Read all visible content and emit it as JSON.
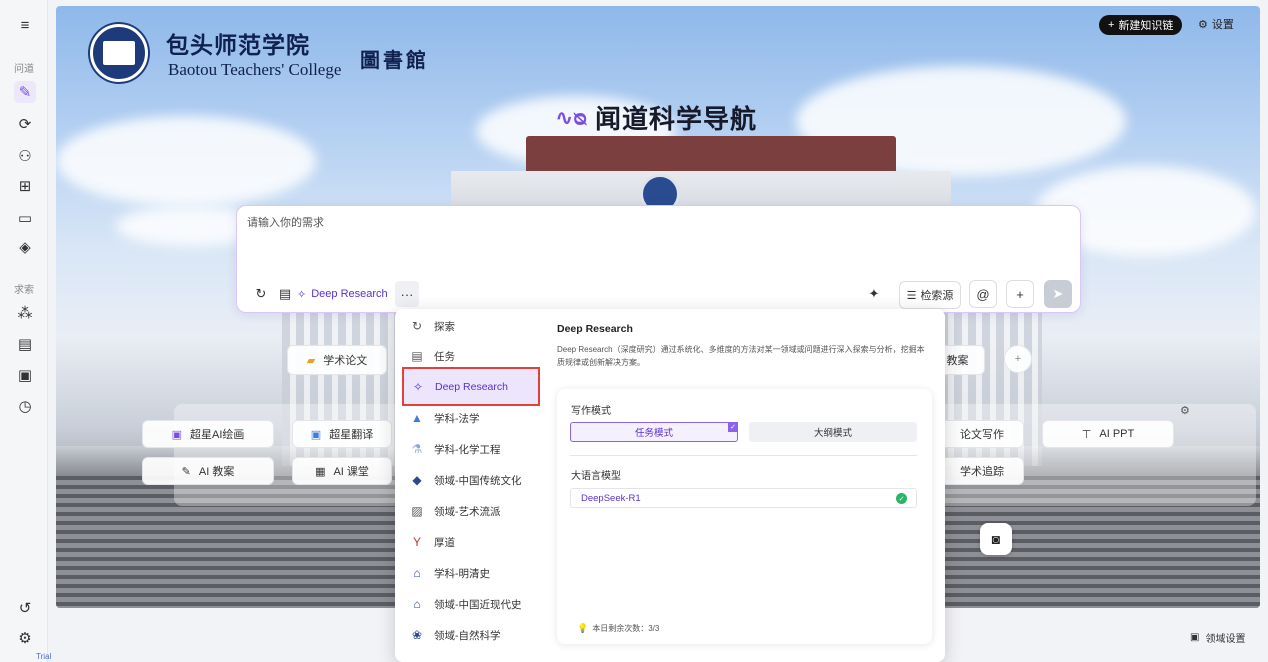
{
  "sidebar": {
    "menu_icon": "hamburger-icon",
    "section1_label": "问道",
    "section2_label": "求索",
    "trial_label": "Trial"
  },
  "header": {
    "college_cn": "包头师范学院",
    "college_en": "Baotou Teachers' College",
    "library_label": "圖書館",
    "new_chain_button": "新建知识链",
    "settings_label": "设置"
  },
  "brand": {
    "title": "闻道科学导航"
  },
  "search": {
    "placeholder": "请输入你的需求",
    "mode_label": "Deep Research",
    "more_label": "···",
    "source_label": "检索源",
    "at_label": "@",
    "plus_label": "+"
  },
  "chips": {
    "academic_paper": "学术论文",
    "lesson_plan": "教案",
    "chaoxing_ai_draw": "超星AI绘画",
    "chaoxing_translate": "超星翻译",
    "ai_lesson_plan": "AI 教案",
    "ai_class": "AI 课堂",
    "paper_writing": "论文写作",
    "ai_ppt": "AI PPT",
    "academic_tracking": "学术追踪"
  },
  "dropdown": {
    "items": [
      {
        "label": "探索",
        "icon": "explore-icon"
      },
      {
        "label": "任务",
        "icon": "task-icon"
      },
      {
        "label": "Deep Research",
        "icon": "telescope-icon"
      },
      {
        "label": "学科-法学",
        "icon": "law-icon"
      },
      {
        "label": "学科-化学工程",
        "icon": "chemistry-icon"
      },
      {
        "label": "领域-中国传统文化",
        "icon": "culture-icon"
      },
      {
        "label": "领域-艺术流派",
        "icon": "art-icon"
      },
      {
        "label": "厚道",
        "icon": "trophy-icon"
      },
      {
        "label": "学科-明清史",
        "icon": "history-icon"
      },
      {
        "label": "领域-中国近现代史",
        "icon": "modern-history-icon"
      },
      {
        "label": "领域-自然科学",
        "icon": "nature-icon"
      }
    ],
    "detail": {
      "title": "Deep Research",
      "description": "Deep Research（深度研究）通过系统化、多维度的方法对某一领域或问题进行深入探索与分析，挖掘本质规律或创新解决方案。",
      "writing_mode_label": "写作模式",
      "mode_task": "任务模式",
      "mode_outline": "大纲模式",
      "llm_label": "大语言模型",
      "model_value": "DeepSeek-R1",
      "quota_text": "本日剩余次数：3/3"
    }
  },
  "footer": {
    "domain_settings": "领域设置"
  },
  "colors": {
    "accent": "#7a4ee6",
    "highlight_border": "#e0413a",
    "ok": "#2fb36b"
  }
}
